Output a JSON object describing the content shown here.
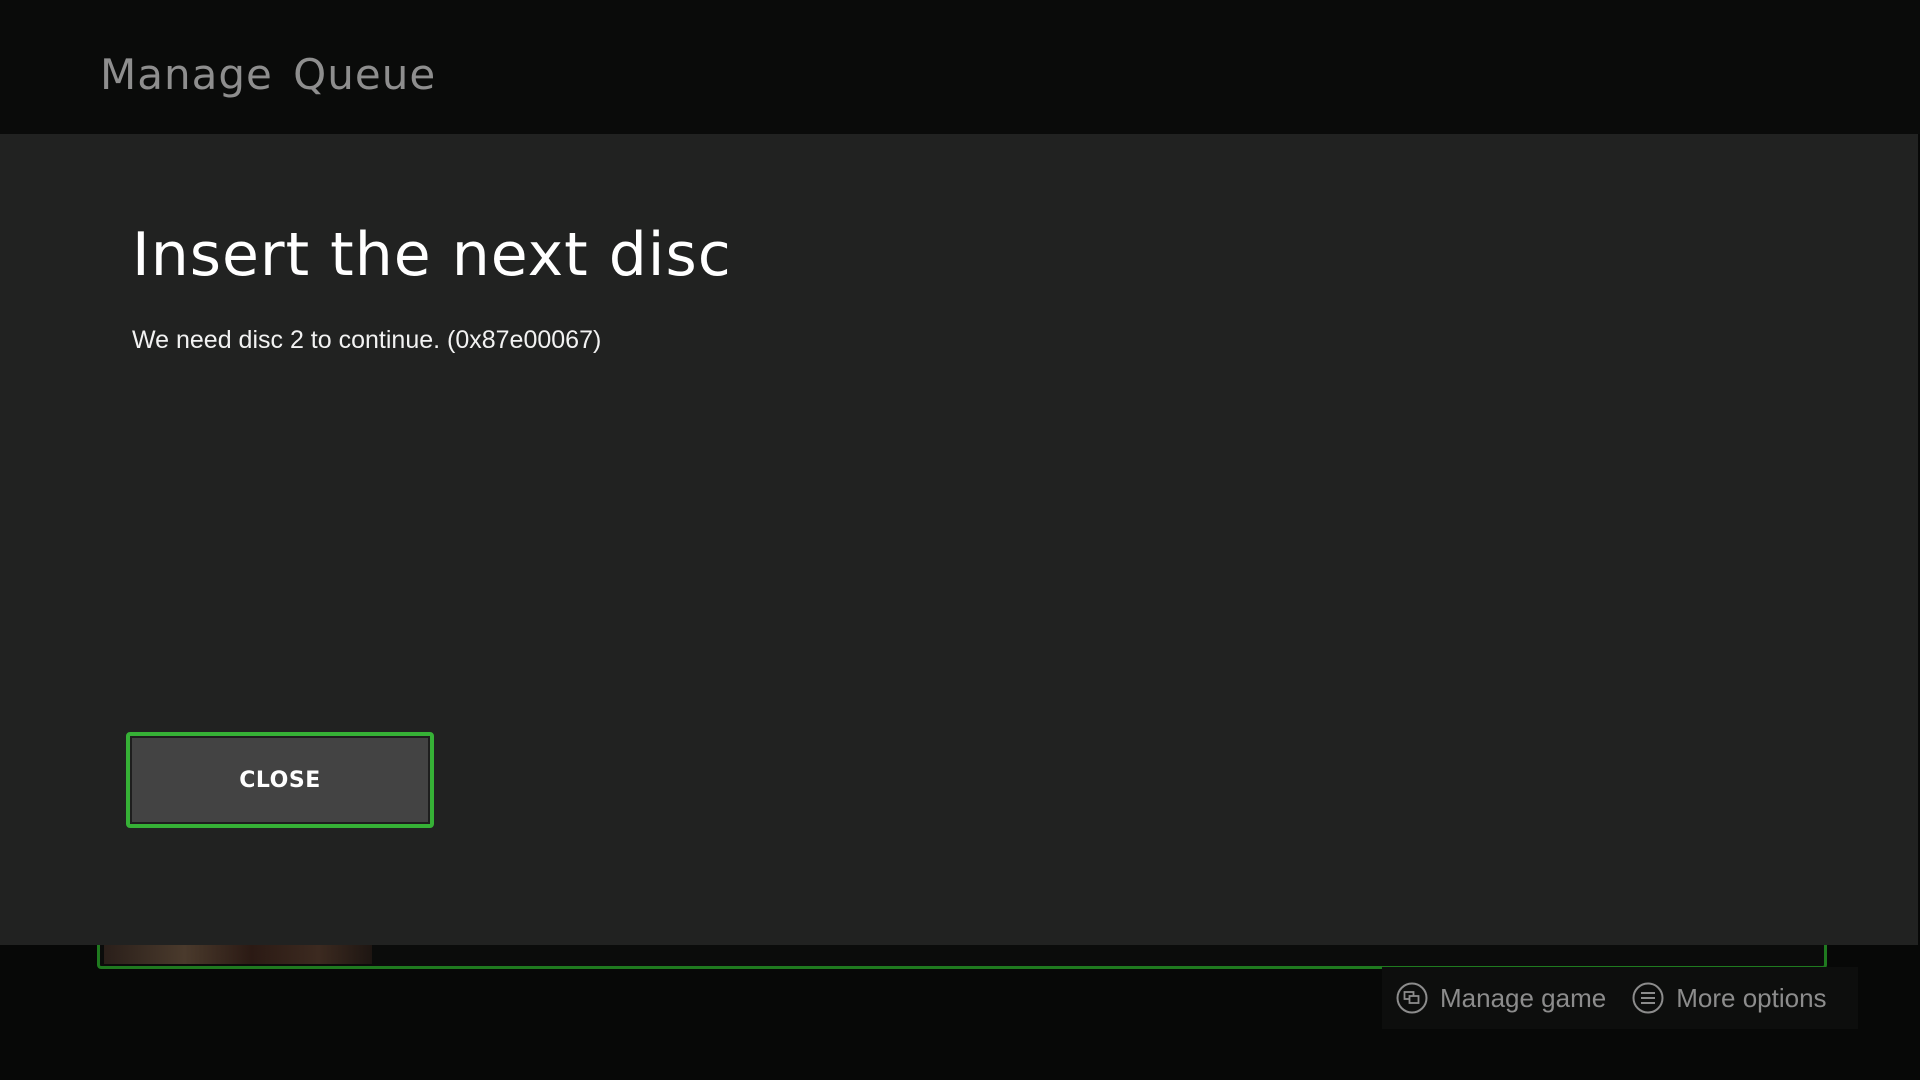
{
  "header": {
    "title": "Manage Queue"
  },
  "dialog": {
    "title": "Insert the next disc",
    "message": "We need disc 2 to continue. (0x87e00067)",
    "close_label": "CLOSE"
  },
  "hints": [
    {
      "label": "Manage game",
      "icon": "view-button-icon"
    },
    {
      "label": "More options",
      "icon": "menu-button-icon"
    }
  ],
  "colors": {
    "accent": "#36b136",
    "dialog_bg": "#212221",
    "button_bg": "#434343"
  }
}
